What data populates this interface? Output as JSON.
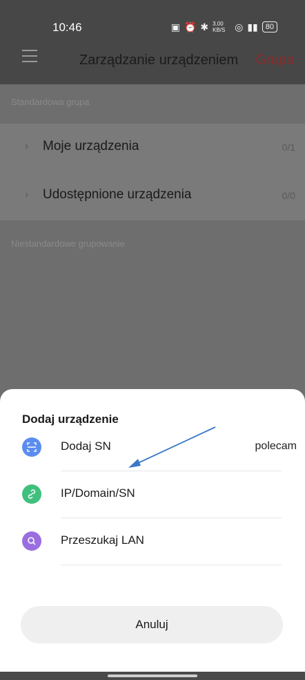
{
  "status_bar": {
    "time": "10:46",
    "icons": [
      "nfc-icon",
      "alarm-icon",
      "bluetooth-icon",
      "data-speed",
      "wifi-icon",
      "volte-icon",
      "signal-icon"
    ],
    "speed": "3.00 KB/S",
    "battery": "80"
  },
  "header": {
    "title": "Zarządzanie urządzeniem",
    "group_link": "Grupa"
  },
  "standard_section": {
    "label": "Standardowa grupa",
    "items": [
      {
        "label": "Moje urządzenia",
        "count": "0/1"
      },
      {
        "label": "Udostępnione urządzenia",
        "count": "0/0"
      }
    ]
  },
  "custom_section": {
    "label": "Niestandardowe grupowanie"
  },
  "sheet": {
    "title": "Dodaj urządzenie",
    "options": [
      {
        "label": "Dodaj SN",
        "hint": "polecam",
        "icon": "scan-icon",
        "color": "#5b8def"
      },
      {
        "label": "IP/Domain/SN",
        "hint": "",
        "icon": "link-icon",
        "color": "#3fc07e"
      },
      {
        "label": "Przeszukaj LAN",
        "hint": "",
        "icon": "search-icon",
        "color": "#9a6ee0"
      }
    ],
    "cancel": "Anuluj"
  },
  "colors": {
    "accent_red": "#8a2d2d",
    "annotation_arrow": "#3a78c8"
  }
}
